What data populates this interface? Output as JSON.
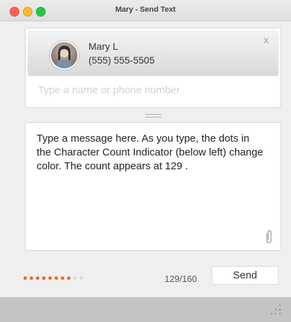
{
  "window": {
    "title": "Mary - Send Text"
  },
  "recipient": {
    "name": "Mary L",
    "phone": "(555) 555-5505",
    "remove_label": "X",
    "input_placeholder": "Type a name or phone number"
  },
  "message": {
    "text": "Type a message here. As you type, the dots in the Character Count Indicator (below left) change color. The count appears at 129 ."
  },
  "footer": {
    "count_text": "129/160",
    "send_label": "Send",
    "indicator": {
      "total_dots": 10,
      "filled_dots": 8,
      "filled_color": "#e8692a",
      "empty_color": "#d8d8d8"
    }
  },
  "icons": {
    "attach": "paperclip-icon",
    "resize": "resize-grip-icon"
  }
}
